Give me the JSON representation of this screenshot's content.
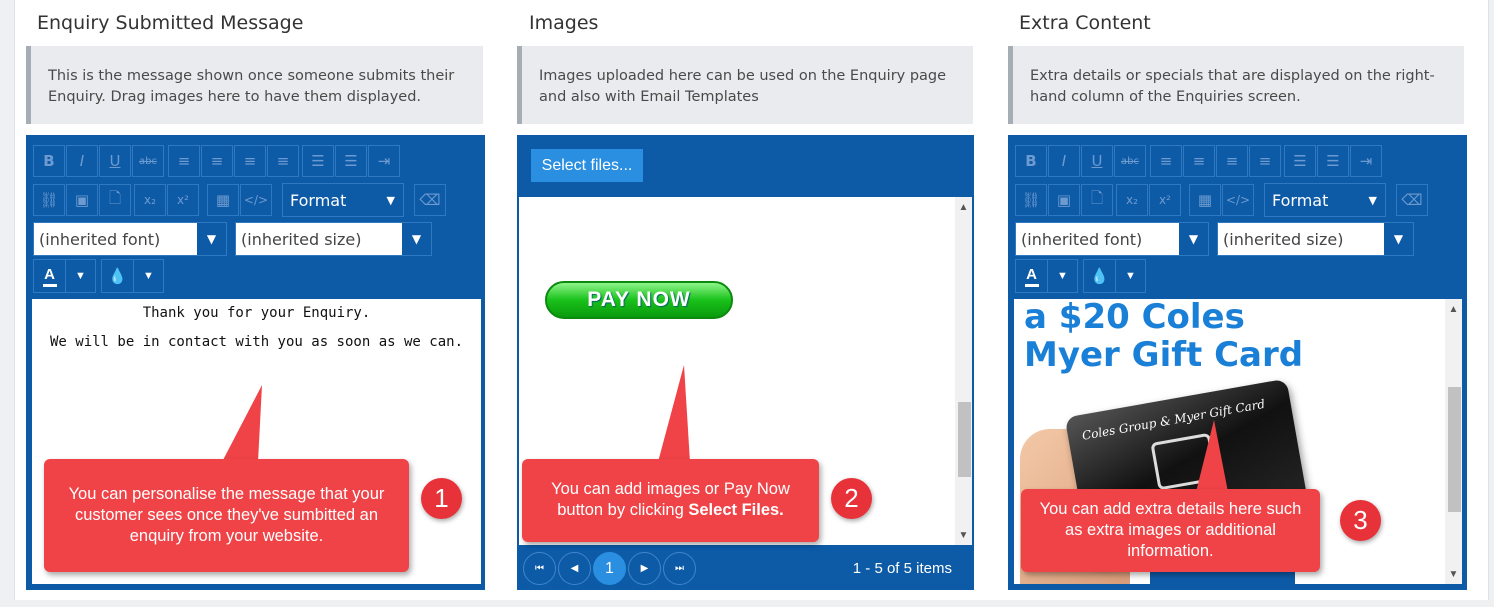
{
  "columns": {
    "enquiry": {
      "title": "Enquiry Submitted Message",
      "info": "This is the message shown once someone submits their Enquiry. Drag images here to have them displayed.",
      "format_label": "Format",
      "font_value": "(inherited font)",
      "size_value": "(inherited size)",
      "content_line1": "Thank you for your Enquiry.",
      "content_line2": "We will be in contact with you as soon as we can."
    },
    "images": {
      "title": "Images",
      "info": "Images uploaded here can be used on the Enquiry page and also with Email Templates",
      "select_files_label": "Select files...",
      "pay_now_label": "PAY NOW",
      "pager_current": "1",
      "pager_summary": "1 - 5 of 5 items"
    },
    "extra": {
      "title": "Extra Content",
      "info": "Extra details or specials that are displayed on the right-hand column of the Enquiries screen.",
      "format_label": "Format",
      "font_value": "(inherited font)",
      "size_value": "(inherited size)",
      "promo_line1": "a $20 Coles",
      "promo_line2": "Myer Gift Card",
      "card_text": "Coles Group & Myer Gift Card"
    }
  },
  "callouts": {
    "c1_text": "You can personalise the message that your customer sees once they've sumbitted an enquiry from your website.",
    "c1_number": "1",
    "c2_text_a": "You can add images or Pay Now button by clicking ",
    "c2_text_b": "Select Files.",
    "c2_number": "2",
    "c3_text": "You can add extra details here such as extra images or additional information.",
    "c3_number": "3"
  },
  "colors": {
    "editor_blue": "#0d5aa7",
    "callout_red": "#f04347",
    "info_bg": "#e9ebee"
  }
}
